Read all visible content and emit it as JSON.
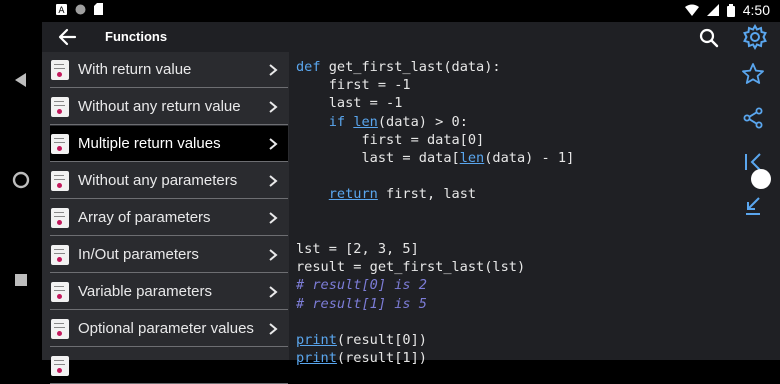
{
  "status_bar": {
    "time": "4:50",
    "left_icons": [
      "a-icon",
      "circle-icon",
      "sd-card-icon"
    ],
    "right_icons": [
      "wifi-icon",
      "signal-icon",
      "battery-icon"
    ]
  },
  "app_bar": {
    "title": "Functions",
    "back_icon": "arrow-left-icon",
    "search_icon": "search-icon",
    "settings_icon": "gear-icon"
  },
  "list": {
    "items": [
      {
        "label": "With return value",
        "selected": false
      },
      {
        "label": "Without any return value",
        "selected": false
      },
      {
        "label": "Multiple return values",
        "selected": true
      },
      {
        "label": "Without any parameters",
        "selected": false
      },
      {
        "label": "Array of parameters",
        "selected": false
      },
      {
        "label": "In/Out parameters",
        "selected": false
      },
      {
        "label": "Variable parameters",
        "selected": false
      },
      {
        "label": "Optional parameter values",
        "selected": false
      },
      {
        "label": "",
        "selected": false
      }
    ]
  },
  "code": {
    "lines": [
      "def get_first_last(data):",
      "    first = -1",
      "    last = -1",
      "    if len(data) > 0:",
      "        first = data[0]",
      "        last = data[len(data) - 1]",
      "",
      "    return first, last",
      "",
      "",
      "lst = [2, 3, 5]",
      "result = get_first_last(lst)",
      "# result[0] is 2",
      "# result[1] is 5",
      "",
      "print(result[0])",
      "print(result[1])"
    ]
  },
  "rail": {
    "tools": [
      "star-icon",
      "share-icon",
      "scroll-to-top-icon",
      "scroll-to-bottom-icon"
    ]
  },
  "colors": {
    "accent": "#5aa6ee",
    "comment": "#7c7cd6",
    "panel": "#2a2b2f",
    "code_bg": "#1f2024"
  }
}
